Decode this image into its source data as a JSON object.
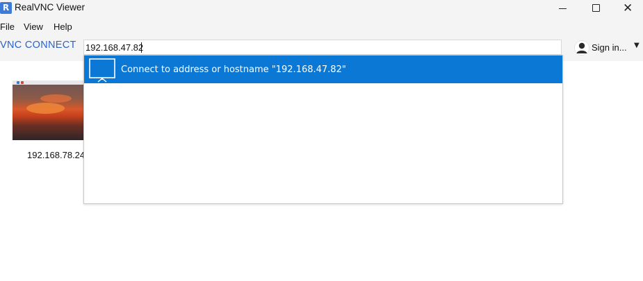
{
  "window": {
    "title": "RealVNC Viewer",
    "app_icon_glyph": "R",
    "icons": {
      "app": "realvnc-app-icon",
      "minimize": "minimize-icon",
      "maximize": "maximize-icon",
      "close": "close-icon"
    },
    "close_glyph": "✕"
  },
  "menu": {
    "items": [
      {
        "label": "File"
      },
      {
        "label": "View"
      },
      {
        "label": "Help"
      }
    ]
  },
  "toolbar": {
    "brand": "VNC CONNECT",
    "search": {
      "value": "192.168.47.82",
      "placeholder": ""
    },
    "signin": {
      "label": "Sign in...",
      "caret_glyph": "▼",
      "icon": "user-icon"
    }
  },
  "dropdown": {
    "suggestion": {
      "label": "Connect to address or hostname \"192.168.47.82\"",
      "icon": "monitor-icon"
    }
  },
  "address_book": {
    "computers": [
      {
        "label": "192.168.78.24"
      }
    ]
  },
  "colors": {
    "accent": "#0a78d4",
    "brand": "#2b63c7",
    "chrome": "#f4f4f4"
  }
}
